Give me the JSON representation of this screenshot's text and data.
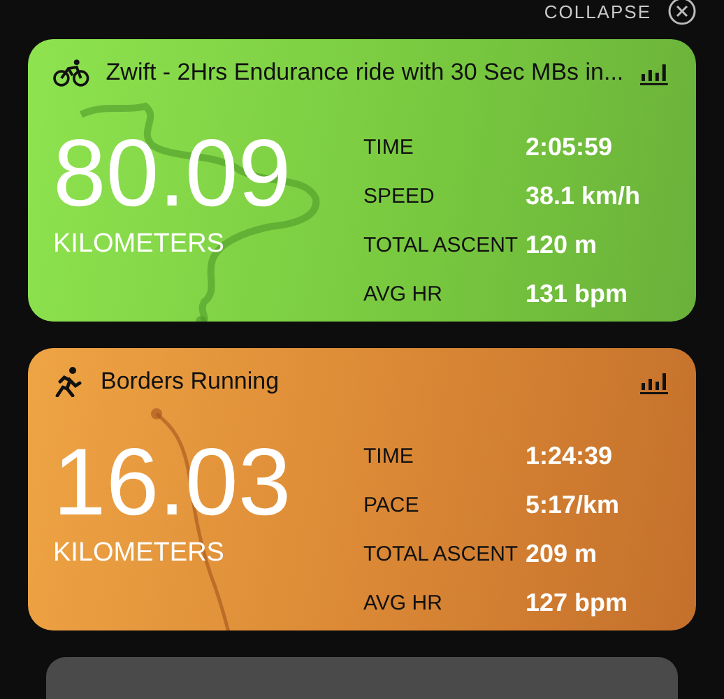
{
  "header": {
    "collapse_label": "COLLAPSE"
  },
  "activities": [
    {
      "kind": "cycling",
      "title": "Zwift - 2Hrs Endurance ride with 30 Sec MBs in...",
      "distance": "80.09",
      "distance_unit": "KILOMETERS",
      "stats": [
        {
          "label": "TIME",
          "value": "2:05:59"
        },
        {
          "label": "SPEED",
          "value": "38.1 km/h"
        },
        {
          "label": "TOTAL ASCENT",
          "value": "120 m"
        },
        {
          "label": "AVG HR",
          "value": "131 bpm"
        }
      ]
    },
    {
      "kind": "running",
      "title": "Borders Running",
      "distance": "16.03",
      "distance_unit": "KILOMETERS",
      "stats": [
        {
          "label": "TIME",
          "value": "1:24:39"
        },
        {
          "label": "PACE",
          "value": "5:17/km"
        },
        {
          "label": "TOTAL ASCENT",
          "value": "209 m"
        },
        {
          "label": "AVG HR",
          "value": "127 bpm"
        }
      ]
    }
  ]
}
